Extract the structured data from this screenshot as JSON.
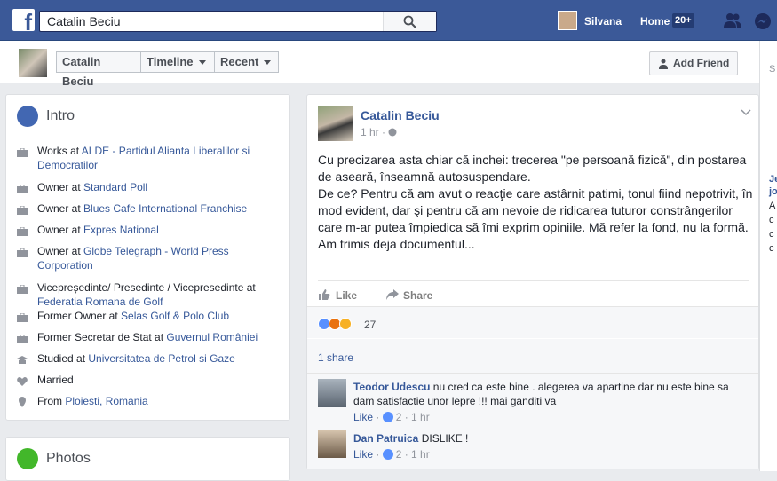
{
  "topbar": {
    "search_value": "Catalin Beciu",
    "user_name": "Silvana",
    "home_label": "Home",
    "home_badge": "20+"
  },
  "subnav": {
    "name": "Catalin Beciu",
    "timeline_label": "Timeline",
    "recent_label": "Recent",
    "add_friend_label": "Add Friend"
  },
  "intro": {
    "title": "Intro",
    "rows": [
      {
        "icon": "briefcase-icon",
        "prefix": "Works at ",
        "link": "ALDE - Partidul Alianta Liberalilor si Democratilor"
      },
      {
        "icon": "briefcase-icon",
        "prefix": "Owner at ",
        "link": "Standard Poll"
      },
      {
        "icon": "briefcase-icon",
        "prefix": "Owner at ",
        "link": "Blues Cafe International Franchise"
      },
      {
        "icon": "briefcase-icon",
        "prefix": "Owner at ",
        "link": "Expres National"
      },
      {
        "icon": "briefcase-icon",
        "prefix": "Owner at ",
        "link": "Globe Telegraph - World Press Corporation"
      },
      {
        "icon": "briefcase-icon",
        "prefix": "Vicepreședinte/ Presedinte / Vicepresedinte at ",
        "link": "Federatia Romana de Golf"
      },
      {
        "icon": "briefcase-icon",
        "prefix": "Former Owner at ",
        "link": "Selas Golf & Polo Club"
      },
      {
        "icon": "briefcase-icon",
        "prefix": "Former Secretar de Stat at ",
        "link": "Guvernul României"
      },
      {
        "icon": "school-icon",
        "prefix": "Studied at ",
        "link": "Universitatea de Petrol si Gaze"
      },
      {
        "icon": "heart-icon",
        "prefix": "Married",
        "link": ""
      },
      {
        "icon": "pin-icon",
        "prefix": "From ",
        "link": "Ploiesti, Romania"
      }
    ]
  },
  "photos": {
    "title": "Photos"
  },
  "post": {
    "author": "Catalin Beciu",
    "time": "1 hr · ",
    "body": [
      "Cu precizarea asta chiar că inchei: trecerea \"pe persoană fizică\", din postarea de aseară, înseamnă autosuspendare.",
      "De ce? Pentru că am avut o reacţie care astârnit patimi, tonul fiind nepotrivit, în mod evident, dar şi pentru că am nevoie de ridicarea tuturor constrângerilor care m-ar putea împiedica să îmi exprim opiniile. Mă refer la fond, nu la formă.",
      "Am trimis deja documentul..."
    ],
    "like_label": "Like",
    "share_label": "Share",
    "reaction_count": "27",
    "shares_label": "1 share"
  },
  "comments": [
    {
      "author": "Teodor Udescu",
      "text": " nu cred ca este bine . alegerea va apartine dar nu este bine sa dam satisfactie unor lepre !!! mai ganditi va",
      "like": "Like",
      "likes": "2",
      "time": "1 hr"
    },
    {
      "author": "Dan Patruica",
      "text": " DISLIKE !",
      "like": "Like",
      "likes": "2",
      "time": "1 hr"
    }
  ],
  "right_rail": {
    "letters": [
      "S",
      "Je",
      "jo",
      "A",
      "c",
      "c",
      "c"
    ]
  },
  "colors": {
    "brand": "#3b5998",
    "link": "#365899",
    "like_blue": "#5890ff"
  }
}
